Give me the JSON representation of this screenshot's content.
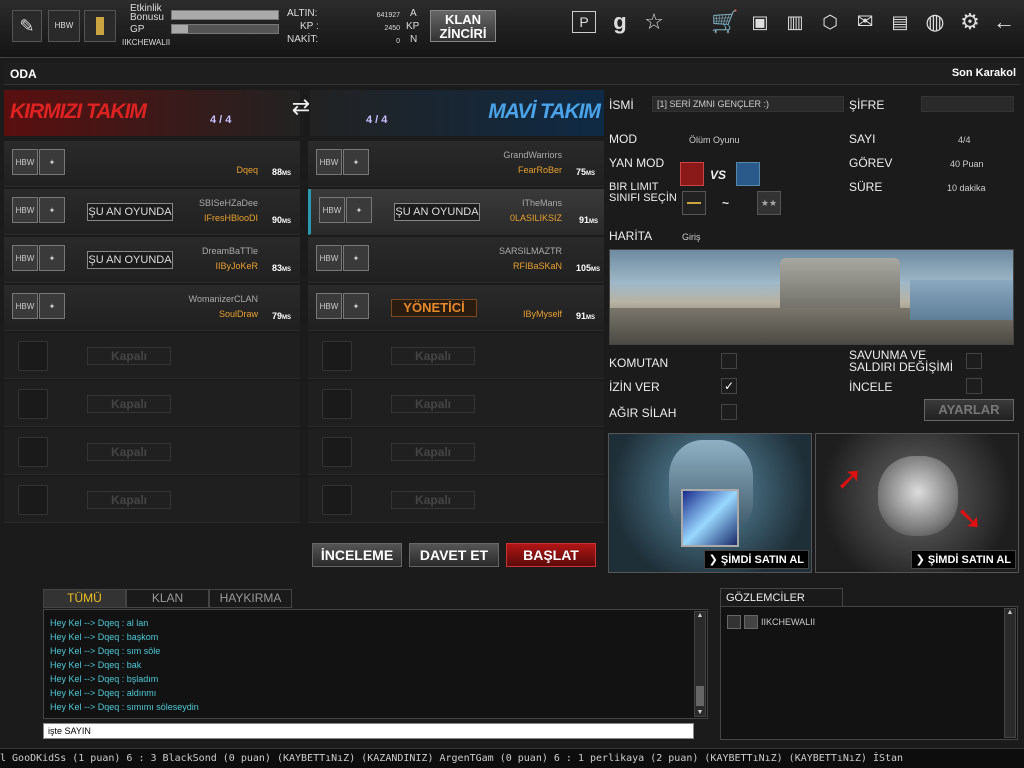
{
  "topbar": {
    "etkinlik_label": "Etkinlik\nBonusu",
    "gp_label": "GP",
    "username": "IIKCHEWALII",
    "altin_label": "ALTIN:",
    "altin_value": "641927",
    "altin_unit": "A",
    "kp_label": "KP :",
    "kp_value": "2450",
    "kp_unit": "KP",
    "nakit_label": "NAKİT:",
    "nakit_value": "0",
    "nakit_unit": "N",
    "klan_button": "KLAN\nZİNCİRİ",
    "g_label": "g",
    "etkinlik_bar": 1.0,
    "gp_bar": 0.15
  },
  "room": {
    "title": "ODA",
    "map_short": "Son Karakol"
  },
  "red_team": {
    "title": "KIRMIZI TAKIM",
    "count": "4 / 4",
    "slots": [
      {
        "status": "",
        "clan": "",
        "name": "Dqeq",
        "ping": "88"
      },
      {
        "status": "ŞU AN OYUNDA",
        "clan": "SBISeHZaDee",
        "name": "IFresHBlooDI",
        "ping": "90"
      },
      {
        "status": "ŞU AN OYUNDA",
        "clan": "DreamBaTTle",
        "name": "IIByJoKeR",
        "ping": "83"
      },
      {
        "status": "",
        "clan": "WomanizerCLAN",
        "name": "SoulDraw",
        "ping": "79"
      }
    ],
    "closed_label": "Kapalı"
  },
  "blue_team": {
    "title": "MAVİ TAKIM",
    "count": "4 / 4",
    "slots": [
      {
        "status": "",
        "clan": "GrandWarriors",
        "name": "FearRoBer",
        "ping": "75"
      },
      {
        "status": "ŞU AN OYUNDA",
        "clan": "ITheMans",
        "name": "0LASILIKSIZ",
        "ping": "91"
      },
      {
        "status": "",
        "clan": "SARSILMAZTR",
        "name": "RFIBaSKaN",
        "ping": "105"
      },
      {
        "status": "YÖNETİCİ",
        "clan": "",
        "name": "IByMyself",
        "ping": "91"
      }
    ],
    "closed_label": "Kapalı"
  },
  "ping_unit": "MS",
  "actions": {
    "inceleme": "İNCELEME",
    "davet": "DAVET ET",
    "baslat": "BAŞLAT"
  },
  "settings": {
    "isim_label": "İSMİ",
    "isim_value": "[1] SERİ ZMNI GENÇLER :)",
    "sifre_label": "ŞİFRE",
    "mod_label": "MOD",
    "mod_value": "Ölüm Oyunu",
    "sayi_label": "SAYI",
    "sayi_value": "4/4",
    "yanmod_label": "YAN MOD",
    "vs_label": "VS",
    "gorev_label": "GÖREV",
    "gorev_value": "40 Puan",
    "sinif_label": "BIR LIMIT\nSINIFI SEÇİN",
    "tilde": "~",
    "sure_label": "SÜRE",
    "sure_value": "10 dakika",
    "harita_label": "HARİTA",
    "harita_value": "Giriş",
    "komutan_label": "KOMUTAN",
    "izinver_label": "İZİN VER",
    "agirsilah_label": "AĞIR SİLAH",
    "savunma_label": "SAVUNMA VE\nSALDIRI DEĞİŞİMİ",
    "incele_label": "İNCELE",
    "izinver_checked": true,
    "ayarlar_button": "AYARLAR"
  },
  "promos": {
    "buy_label": "ŞİMDİ SATIN AL"
  },
  "chat": {
    "tabs": [
      "TÜMÜ",
      "KLAN",
      "HAYKIRMA"
    ],
    "messages": [
      "Hey  Kel -->  Dqeq  : al lan",
      "Hey  Kel -->  Dqeq  : başkom",
      "Hey  Kel -->  Dqeq  : sım söle",
      "Hey  Kel -->  Dqeq  : bak",
      "Hey  Kel -->  Dqeq  : bşladım",
      "Hey  Kel -->  Dqeq  : aldınmı",
      "Hey  Kel -->  Dqeq  : sımımı söleseydin"
    ],
    "input_value": "işte SAYIN"
  },
  "observers": {
    "title": "GÖZLEMCİLER",
    "list": [
      "IIKCHEWALII"
    ]
  },
  "ticker": "l GooDKidSs (1 puan) 6 : 3 BlackSond (0 puan) (KAYBETTıNıZ)     (KAZANDINIZ) ArgenTGam (0 puan) 6 : 1 perlikaya (2 puan) (KAYBETTıNıZ)     (KAYBETTıNıZ) İStan"
}
